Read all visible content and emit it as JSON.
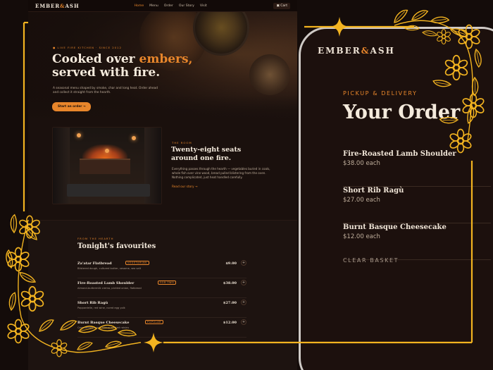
{
  "desktop": {
    "brand": {
      "name_a": "EMBER",
      "amp": "&",
      "name_b": "ASH"
    },
    "nav": {
      "items": [
        "Home",
        "Menu",
        "Order",
        "Our Story",
        "Visit"
      ],
      "cart_label": "Cart"
    },
    "hero": {
      "eyebrow": "● LIVE FIRE KITCHEN · SINCE 2012",
      "title_a": "Cooked over ",
      "title_accent": "embers,",
      "title_b": "served with fire.",
      "body": "A seasonal menu shaped by smoke, char and long heat. Order ahead and collect it straight from the hearth.",
      "cta": "Start an order →"
    },
    "room": {
      "eyebrow": "THE ROOM",
      "title": "Twenty-eight seats around one fire.",
      "body": "Everything passes through the hearth — vegetables buried in coals, whole fish over vine wood, bread pulled blistering from the oven. Nothing complicated, just heat handled carefully.",
      "link": "Read our story →"
    },
    "menu": {
      "eyebrow": "FROM THE HEARTH",
      "title": "Tonight's favourites",
      "items": [
        {
          "name": "Za'atar Flatbread",
          "tag": "VEGETARIAN",
          "desc": "Blistered dough, cultured butter, sesame, sea salt",
          "price": "$9.00"
        },
        {
          "name": "Fire-Roasted Lamb Shoulder",
          "tag": "FOR TWO",
          "desc": "Almond-buttermilk crema, pickled onion, flatbread",
          "price": "$38.00"
        },
        {
          "name": "Short Rib Ragù",
          "tag": "",
          "desc": "Pappardelle, red wine, cured egg yolk",
          "price": "$27.00"
        },
        {
          "name": "Burnt Basque Cheesecake",
          "tag": "POPULAR",
          "desc": "Caramelised crust, sherry-soaked raisins",
          "price": "$12.00"
        }
      ],
      "add_symbol": "+"
    }
  },
  "phone": {
    "brand": {
      "name_a": "EMBER",
      "amp": "&",
      "name_b": "ASH"
    },
    "eyebrow": "PICKUP & DELIVERY",
    "title": "Your Order",
    "items": [
      {
        "name": "Fire-Roasted Lamb Shoulder",
        "price": "$38.00 each"
      },
      {
        "name": "Short Rib Ragù",
        "price": "$27.00 each"
      },
      {
        "name": "Burnt Basque Cheesecake",
        "price": "$12.00 each"
      }
    ],
    "clear_label": "CLEAR BASKET"
  },
  "colors": {
    "accent": "#e8862b",
    "gold": "#f2b320",
    "background": "#140c0a",
    "text": "#f4eadc"
  },
  "decoration": {
    "frame_motif": "gold-floral-vine-frame",
    "icons": [
      "sparkle-star-icon",
      "flower-icon",
      "leaf-icon"
    ]
  }
}
